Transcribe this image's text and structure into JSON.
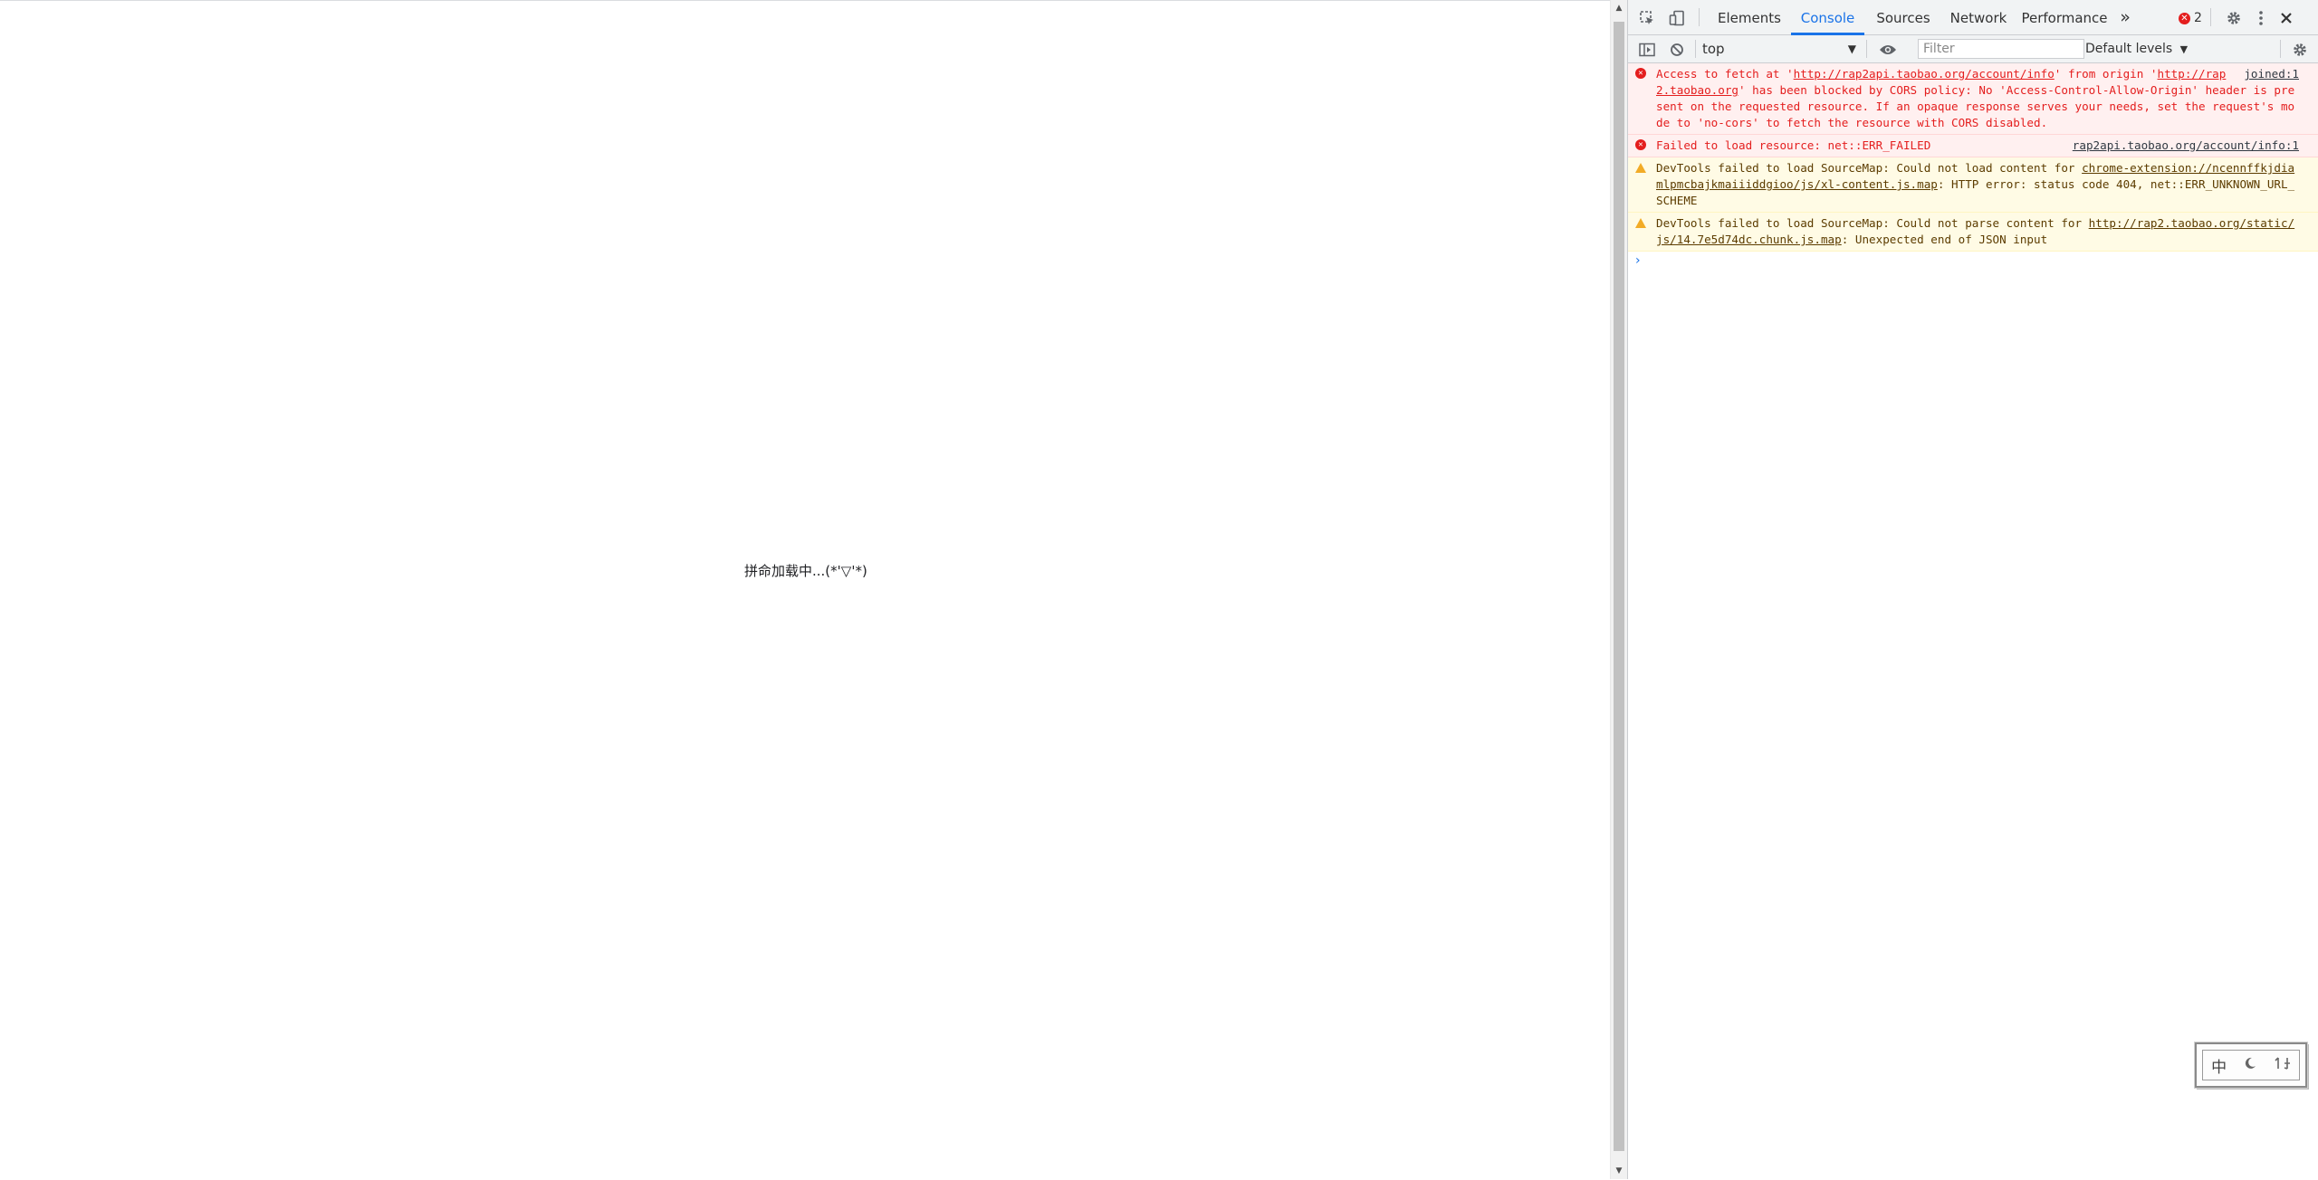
{
  "page": {
    "loading_text": "拼命加载中...(*'▽'*)"
  },
  "devtools": {
    "tabs": [
      {
        "label": "Elements"
      },
      {
        "label": "Console"
      },
      {
        "label": "Sources"
      },
      {
        "label": "Network"
      },
      {
        "label": "Performance"
      }
    ],
    "active_tab": "Console",
    "more_tabs_icon": "»",
    "error_count": "2",
    "toolbar": {
      "context": "top",
      "filter_placeholder": "Filter",
      "levels_label": "Default levels"
    },
    "messages": [
      {
        "level": "error",
        "pre": "Access to fetch at '",
        "link1": "http://rap2api.taobao.org/account/info",
        "mid": "' from origin '",
        "link2": "http://rap2.taobao.org",
        "post": "' has been blocked by CORS policy: No 'Access-Control-Allow-Origin' header is present on the requested resource. If an opaque response serves your needs, set the request's mode to 'no-cors' to fetch the resource with CORS disabled.",
        "source": "joined:1"
      },
      {
        "level": "error",
        "text": "Failed to load resource: net::ERR_FAILED",
        "source": "rap2api.taobao.org/account/info:1"
      },
      {
        "level": "warning",
        "pre": "DevTools failed to load SourceMap: Could not load content for ",
        "link": "chrome-extension://ncennffkjdiamlpmcbajkmaiiiddgioo/js/xl-content.js.map",
        "post": ": HTTP error: status code 404, net::ERR_UNKNOWN_URL_SCHEME"
      },
      {
        "level": "warning",
        "pre": "DevTools failed to load SourceMap: Could not parse content for ",
        "link": "http://rap2.taobao.org/static/js/14.7e5d74dc.chunk.js.map",
        "post": ": Unexpected end of JSON input"
      }
    ],
    "prompt_symbol": "›"
  },
  "ime": {
    "lang": "中",
    "mode_icon": "moon-icon",
    "width_icon": "half-width-icon"
  },
  "colors": {
    "accent": "#1a73e8",
    "error_text": "#e41e1e",
    "error_bg": "#fff0f0",
    "warning_bg": "#fffbe5",
    "warning_text": "#5c3c00"
  }
}
